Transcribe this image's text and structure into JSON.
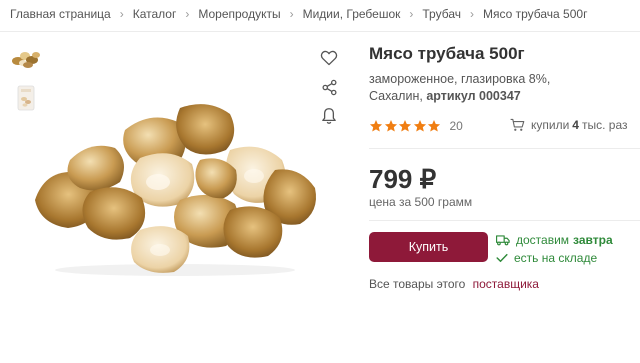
{
  "breadcrumb": {
    "items": [
      "Главная страница",
      "Каталог",
      "Морепродукты",
      "Мидии, Гребешок",
      "Трубач"
    ],
    "current": "Мясо трубача 500г"
  },
  "product": {
    "title": "Мясо трубача 500г",
    "desc_line1": "замороженное, глазировка 8%,",
    "desc_line2_prefix": "Сахалин,",
    "sku_label": "артикул",
    "sku": "000347",
    "rating_value": 5,
    "rating_count": "20",
    "bought_prefix": "купили",
    "bought_count": "4",
    "bought_suffix": "тыс. раз",
    "price": "799 ₽",
    "price_note": "цена за 500 грамм",
    "buy_label": "Купить",
    "delivery_label": "доставим",
    "delivery_when": "завтра",
    "stock_label": "есть на складе",
    "supplier_prefix": "Все товары этого",
    "supplier_link": "поставщика"
  },
  "icons": {
    "favorite": "heart-icon",
    "share": "share-icon",
    "notify": "bell-icon",
    "cart": "cart-icon",
    "truck": "truck-icon",
    "check": "check-icon",
    "star": "star-icon"
  },
  "colors": {
    "accent": "#8e1939",
    "star": "#f07e12",
    "success": "#2f8a3a"
  }
}
